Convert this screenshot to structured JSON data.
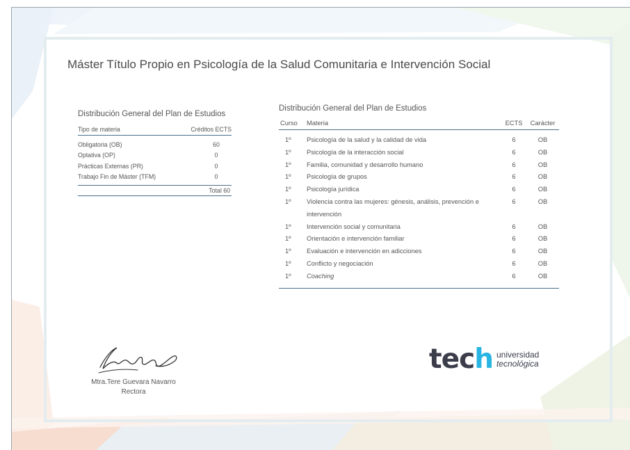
{
  "title": "Máster Título Propio en Psicología de la Salud Comunitaria e Intervención Social",
  "summary": {
    "heading": "Distribución General del Plan de Estudios",
    "col_type": "Tipo de materia",
    "col_credits": "Créditos ECTS",
    "rows": [
      {
        "type": "Obligatoria (OB)",
        "credits": "60"
      },
      {
        "type": "Optativa (OP)",
        "credits": "0"
      },
      {
        "type": "Prácticas Externas (PR)",
        "credits": "0"
      },
      {
        "type": "Trabajo Fin de Máster (TFM)",
        "credits": "0"
      }
    ],
    "total": "Total 60"
  },
  "subjects": {
    "heading": "Distribución General del Plan de Estudios",
    "col_course": "Curso",
    "col_subject": "Materia",
    "col_ects": "ECTS",
    "col_type": "Carácter",
    "rows": [
      {
        "course": "1º",
        "subject": "Psicología de la salud y la calidad de vida",
        "ects": "6",
        "type": "OB"
      },
      {
        "course": "1º",
        "subject": "Psicología de la interacción social",
        "ects": "6",
        "type": "OB"
      },
      {
        "course": "1º",
        "subject": "Familia, comunidad y desarrollo humano",
        "ects": "6",
        "type": "OB"
      },
      {
        "course": "1º",
        "subject": "Psicología de grupos",
        "ects": "6",
        "type": "OB"
      },
      {
        "course": "1º",
        "subject": "Psicología jurídica",
        "ects": "6",
        "type": "OB"
      },
      {
        "course": "1º",
        "subject": "Violencia contra las mujeres: génesis, análisis, prevención e intervención",
        "ects": "6",
        "type": "OB"
      },
      {
        "course": "1º",
        "subject": "Intervención social y comunitaria",
        "ects": "6",
        "type": "OB"
      },
      {
        "course": "1º",
        "subject": "Orientación e intervención familiar",
        "ects": "6",
        "type": "OB"
      },
      {
        "course": "1º",
        "subject": "Evaluación e intervención en adicciones",
        "ects": "6",
        "type": "OB"
      },
      {
        "course": "1º",
        "subject": "Conflicto y negociación",
        "ects": "6",
        "type": "OB"
      },
      {
        "course": "1º",
        "subject": "Coaching",
        "ects": "6",
        "type": "OB"
      }
    ]
  },
  "signer": {
    "name": "Mtra.Tere Guevara Navarro",
    "role": "Rectora"
  },
  "logo": {
    "word_main": "tec",
    "word_h": "h",
    "line1": "universidad",
    "line2": "tecnológica",
    "color_dark": "#3b3d4b",
    "color_accent": "#29b5e3"
  }
}
